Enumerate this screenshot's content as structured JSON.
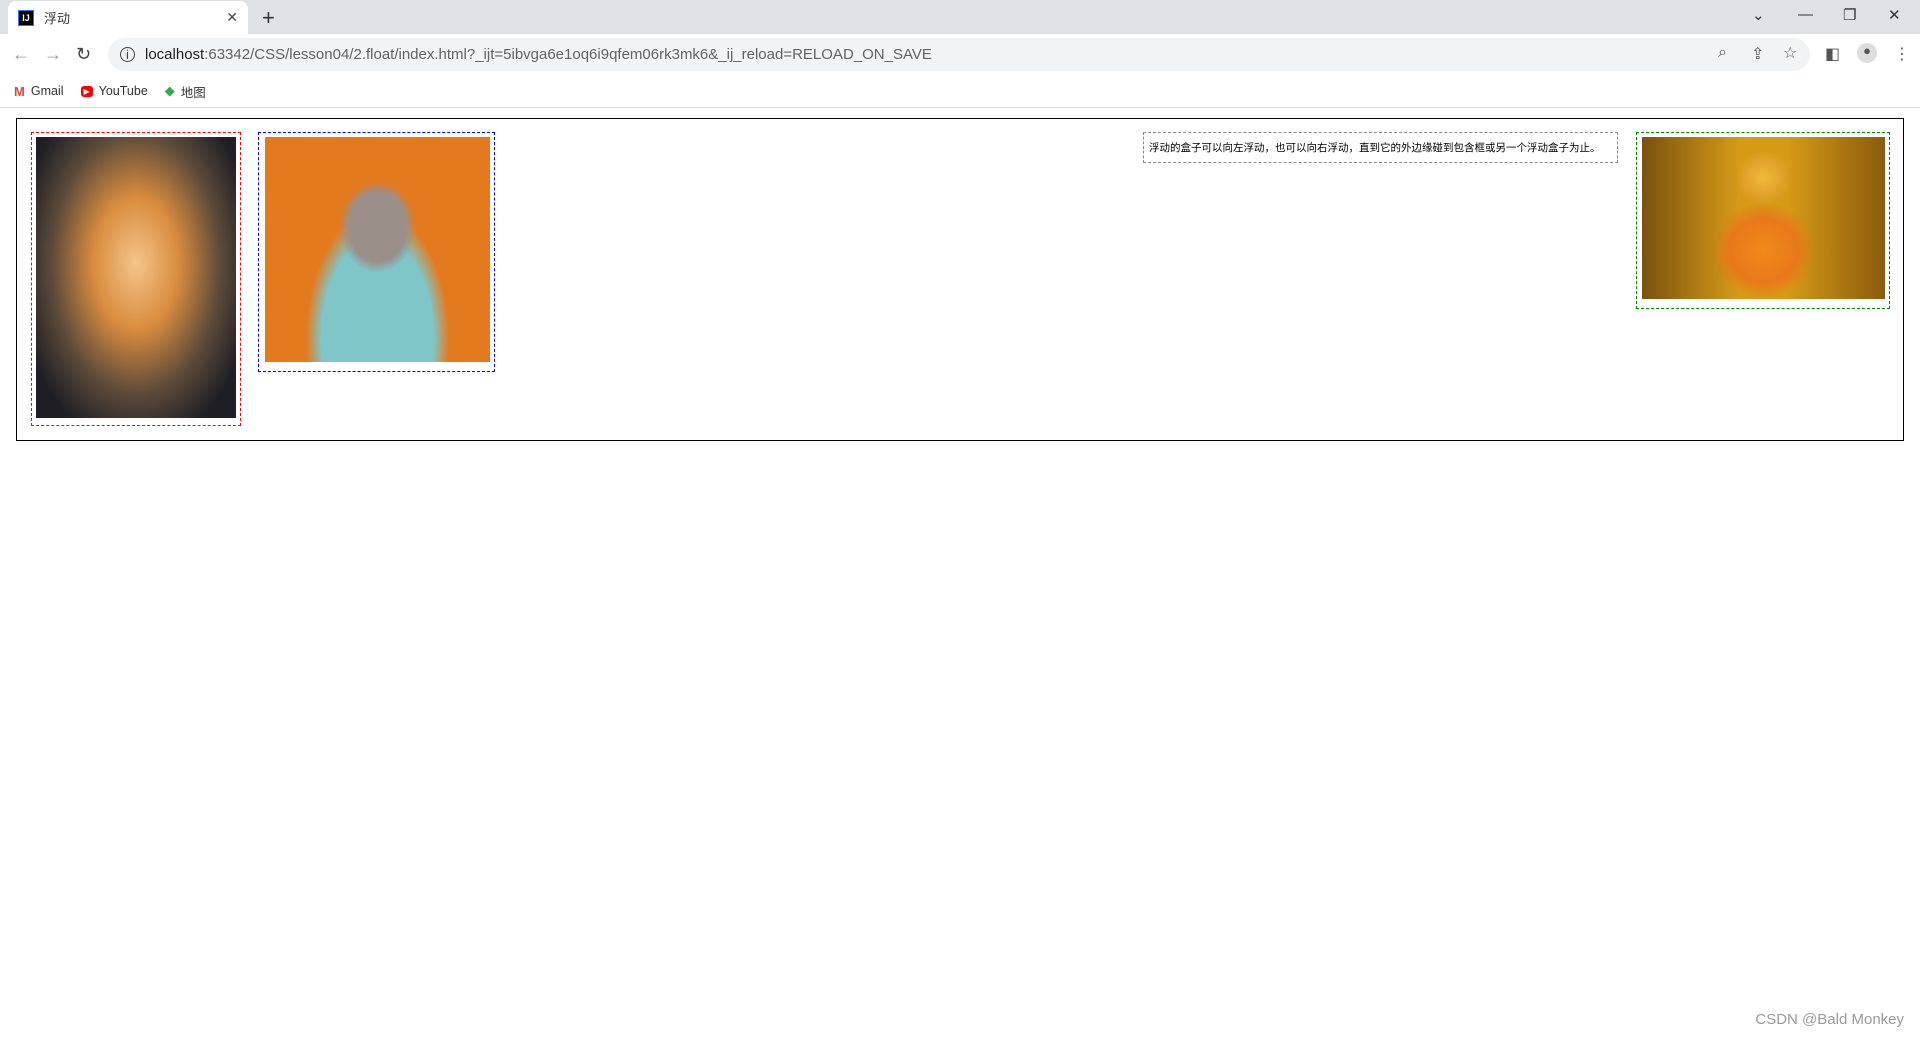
{
  "browser": {
    "tab_title": "浮动",
    "favicon_text": "IJ",
    "url_host": "localhost",
    "url_rest": ":63342/CSS/lesson04/2.float/index.html?_ijt=5ibvga6e1oq6i9qfem06rk3mk6&_ij_reload=RELOAD_ON_SAVE",
    "bookmarks": [
      {
        "label": "Gmail",
        "icon": "gmail-icon",
        "color": "#ea4335"
      },
      {
        "label": "YouTube",
        "icon": "youtube-icon",
        "color": "#ff0000"
      },
      {
        "label": "地图",
        "icon": "maps-icon",
        "color": "#34a853"
      }
    ]
  },
  "page": {
    "float_text": "浮动的盒子可以向左浮动，也可以向右浮动，直到它的外边缘碰到包含框或另一个浮动盒子为止。",
    "images": [
      {
        "subject": "shiba dog in tuxedo",
        "border_color": "#ff0000"
      },
      {
        "subject": "rabbit in sunglasses and teal suit",
        "border_color": "#0000ff"
      },
      {
        "subject": "giraffe with knit hat and scarf",
        "border_color": "#008000"
      }
    ]
  },
  "watermark": "CSDN @Bald Monkey"
}
